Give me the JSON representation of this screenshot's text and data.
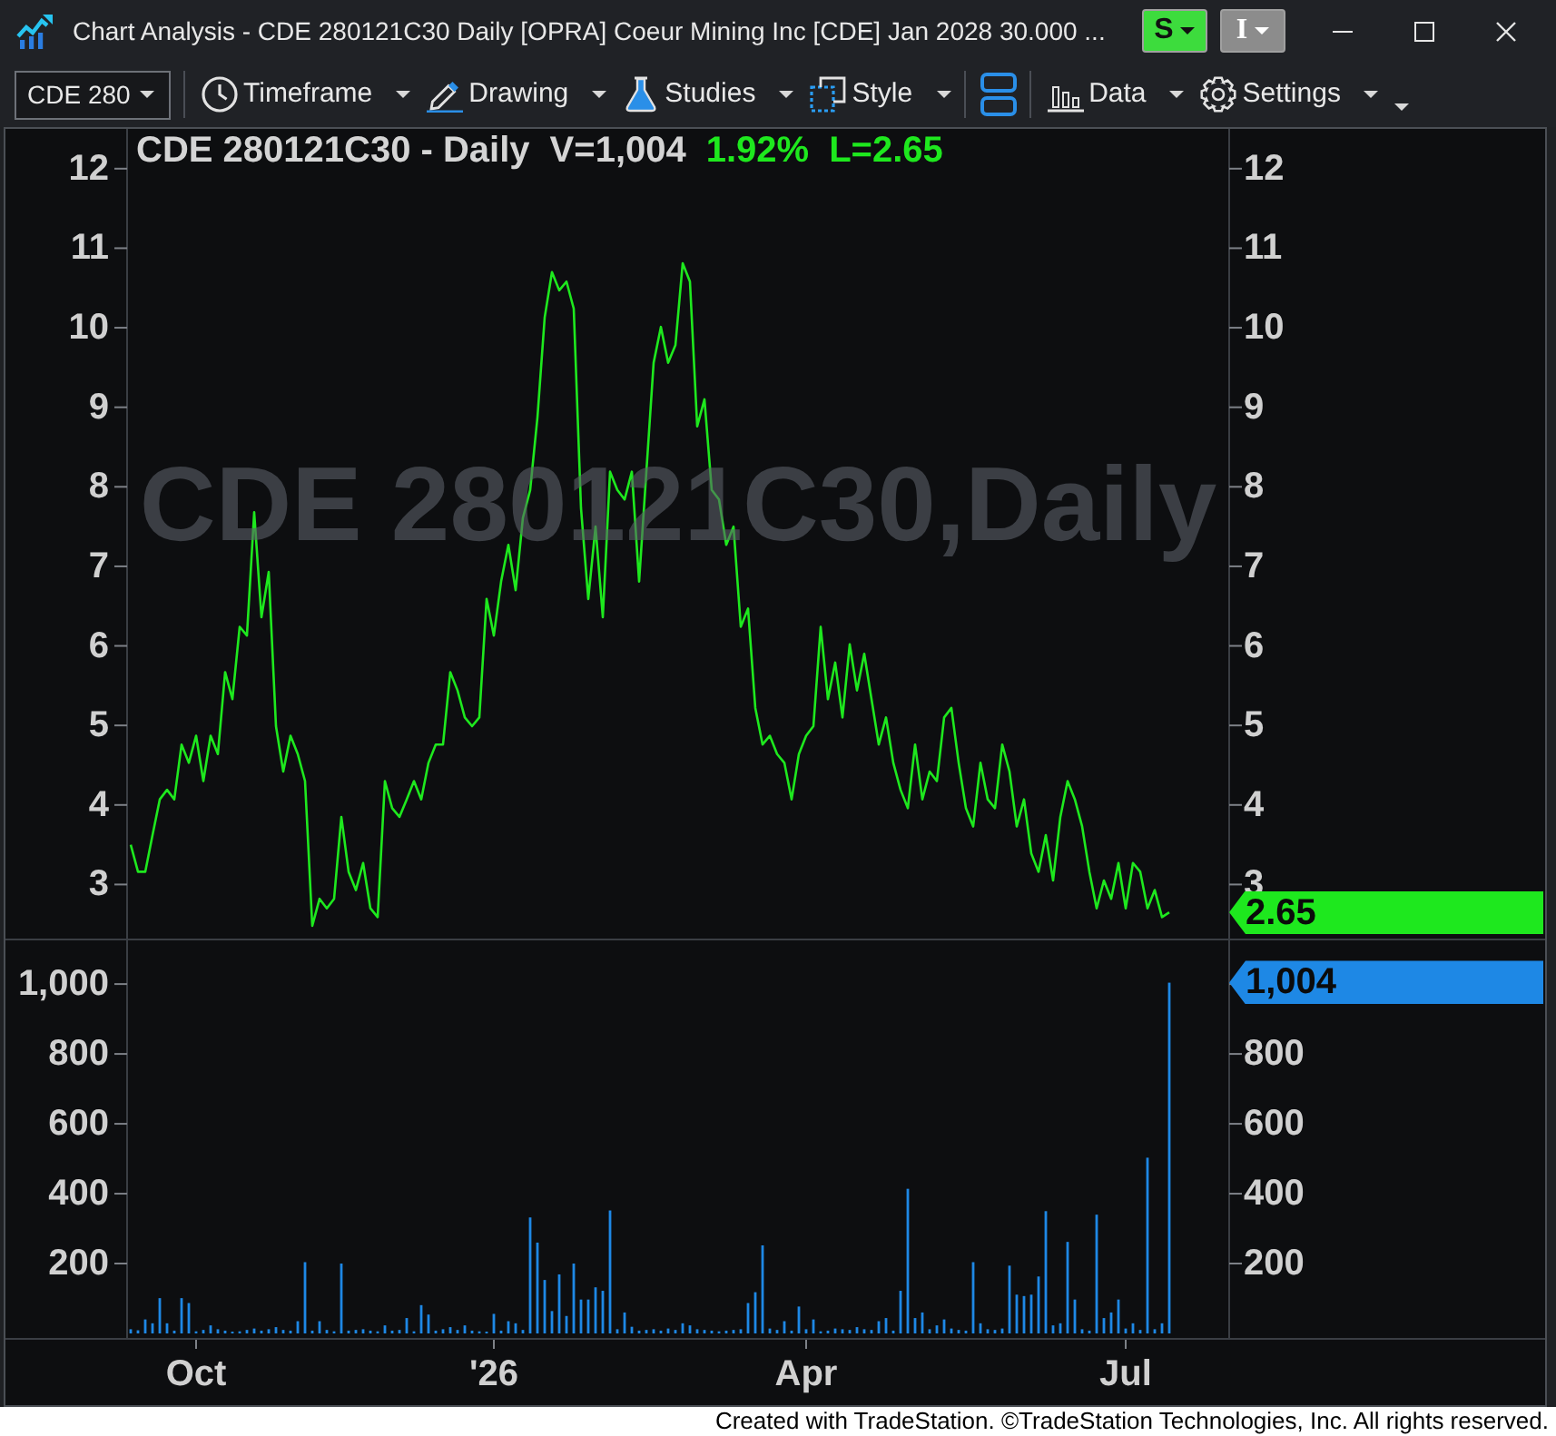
{
  "window": {
    "title": "Chart Analysis - CDE 280121C30 Daily [OPRA] Coeur Mining Inc [CDE] Jan 2028 30.000 ...",
    "title_buttons": [
      {
        "label": "S",
        "color": "#3ddc3d"
      },
      {
        "label": "I",
        "color": "#8c8c8c"
      }
    ]
  },
  "toolbar": {
    "symbol": "CDE 280",
    "items": [
      {
        "kind": "separator"
      },
      {
        "kind": "menu",
        "label": "Timeframe"
      },
      {
        "kind": "menu",
        "label": "Drawing"
      },
      {
        "kind": "menu",
        "label": "Studies"
      },
      {
        "kind": "menu",
        "label": "Style"
      },
      {
        "kind": "separator"
      },
      {
        "kind": "icon_button"
      },
      {
        "kind": "separator"
      },
      {
        "kind": "menu",
        "label": "Data"
      },
      {
        "kind": "menu",
        "label": "Settings"
      },
      {
        "kind": "overflow"
      }
    ]
  },
  "chart": {
    "price_panel": {
      "header": [
        {
          "text": "CDE 280121C30 - Daily",
          "color": "#d4d4d4"
        },
        {
          "text": "V=1,004",
          "color": "#d4d4d4"
        },
        {
          "text": "1.92%",
          "color": "#1ee81e"
        },
        {
          "text": "L=2.65",
          "color": "#1ee81e"
        }
      ],
      "background_text": "CDE 280121C30,Daily",
      "right_axis_labels": [
        "12",
        "11",
        "10",
        "9",
        "8",
        "7",
        "6",
        "5",
        "4",
        "3"
      ],
      "last_price_tag": "2.65",
      "chart_data": {
        "type": "line",
        "series": [
          {
            "color": "#1ee81e",
            "values": [
              3.5,
              3.16,
              3.16,
              3.62,
              4.07,
              4.19,
              4.07,
              4.76,
              4.53,
              4.87,
              4.3,
              4.87,
              4.64,
              5.67,
              5.33,
              6.24,
              6.13,
              7.68,
              6.36,
              6.93,
              4.99,
              4.42,
              4.87,
              4.64,
              4.3,
              2.48,
              2.82,
              2.7,
              2.82,
              3.85,
              3.16,
              2.93,
              3.27,
              2.7,
              2.59,
              4.3,
              3.96,
              3.85,
              4.07,
              4.3,
              4.07,
              4.53,
              4.76,
              4.76,
              5.67,
              5.44,
              5.1,
              4.99,
              5.1,
              6.59,
              6.13,
              6.81,
              7.27,
              6.7,
              7.61,
              7.96,
              8.87,
              10.13,
              10.7,
              10.47,
              10.58,
              10.24,
              7.73,
              6.59,
              7.5,
              6.36,
              8.19,
              7.96,
              7.84,
              8.19,
              6.81,
              8.19,
              9.56,
              10.01,
              9.56,
              9.78,
              10.81,
              10.58,
              8.76,
              9.1,
              7.96,
              7.84,
              7.27,
              7.5,
              6.24,
              6.47,
              5.22,
              4.76,
              4.87,
              4.64,
              4.53,
              4.07,
              4.64,
              4.87,
              4.99,
              6.24,
              5.33,
              5.79,
              5.1,
              6.02,
              5.44,
              5.9,
              5.33,
              4.76,
              5.1,
              4.53,
              4.19,
              3.96,
              4.76,
              4.07,
              4.42,
              4.3,
              5.1,
              5.22,
              4.53,
              3.96,
              3.73,
              4.53,
              4.07,
              3.96,
              4.76,
              4.42,
              3.73,
              4.07,
              3.39,
              3.16,
              3.62,
              3.05,
              3.85,
              4.3,
              4.07,
              3.73,
              3.16,
              2.7,
              3.05,
              2.82,
              3.27,
              2.7,
              3.27,
              3.16,
              2.7,
              2.93,
              2.59,
              2.65
            ]
          }
        ],
        "ylim": [
          2.32,
          12.5
        ],
        "yticks": [
          {
            "value": 12,
            "label": "12"
          },
          {
            "value": 11,
            "label": "11"
          },
          {
            "value": 10,
            "label": "10"
          },
          {
            "value": 9,
            "label": "9"
          },
          {
            "value": 8,
            "label": "8"
          },
          {
            "value": 7,
            "label": "7"
          },
          {
            "value": 6,
            "label": "6"
          },
          {
            "value": 5,
            "label": "5"
          },
          {
            "value": 4,
            "label": "4"
          },
          {
            "value": 3,
            "label": "3"
          }
        ]
      }
    },
    "volume_panel": {
      "right_axis_labels": [
        "800",
        "600",
        "400",
        "200"
      ],
      "last_volume_tag": "1,004",
      "chart_data": {
        "type": "bar",
        "categories": [
          null,
          null,
          null,
          null,
          null,
          null,
          null,
          null,
          null,
          "Oct",
          null,
          null,
          null,
          null,
          null,
          null,
          null,
          null,
          null,
          null,
          null,
          null,
          null,
          null,
          null,
          null,
          null,
          null,
          null,
          null,
          null,
          null,
          null,
          null,
          null,
          null,
          null,
          null,
          null,
          null,
          null,
          null,
          null,
          null,
          null,
          null,
          null,
          null,
          null,
          null,
          "'26",
          null,
          null,
          null,
          null,
          null,
          null,
          null,
          null,
          null,
          null,
          null,
          null,
          null,
          null,
          null,
          null,
          null,
          null,
          null,
          null,
          null,
          null,
          null,
          null,
          null,
          null,
          null,
          null,
          null,
          null,
          null,
          null,
          null,
          null,
          null,
          null,
          null,
          null,
          null,
          null,
          null,
          null,
          "Apr",
          null,
          null,
          null,
          null,
          null,
          null,
          null,
          null,
          null,
          null,
          null,
          null,
          null,
          null,
          null,
          null,
          null,
          null,
          null,
          null,
          null,
          null,
          null,
          null,
          null,
          null,
          null,
          null,
          null,
          null,
          null,
          null,
          null,
          null,
          null,
          null,
          null,
          null,
          null,
          null,
          null,
          null,
          null,
          "Jul",
          null,
          null,
          null,
          null,
          null,
          null
        ],
        "series": [
          {
            "color": "#1e88e5",
            "values": [
              12,
              9,
              40,
              29,
              101,
              29,
              8,
              101,
              87,
              6,
              10,
              23,
              12,
              8,
              5,
              6,
              10,
              14,
              8,
              12,
              18,
              10,
              8,
              35,
              204,
              8,
              35,
              10,
              6,
              200,
              8,
              10,
              12,
              8,
              6,
              23,
              8,
              10,
              44,
              6,
              81,
              54,
              8,
              12,
              18,
              10,
              23,
              8,
              6,
              5,
              56,
              8,
              35,
              29,
              10,
              332,
              260,
              153,
              64,
              169,
              50,
              200,
              97,
              97,
              132,
              122,
              352,
              12,
              60,
              19,
              8,
              10,
              12,
              8,
              14,
              10,
              29,
              23,
              12,
              10,
              8,
              6,
              8,
              10,
              12,
              87,
              118,
              252,
              14,
              10,
              35,
              8,
              77,
              12,
              40,
              6,
              8,
              14,
              12,
              10,
              18,
              12,
              10,
              35,
              44,
              8,
              122,
              414,
              44,
              60,
              12,
              23,
              40,
              14,
              10,
              8,
              204,
              29,
              12,
              10,
              14,
              194,
              111,
              107,
              111,
              163,
              350,
              23,
              29,
              262,
              97,
              12,
              8,
              340,
              44,
              60,
              97,
              14,
              29,
              10,
              503,
              12,
              29,
              1004
            ]
          }
        ],
        "ylim": [
          -13,
          1125
        ],
        "yticks": [
          {
            "value": 1000,
            "label": "1,000"
          },
          {
            "value": 800,
            "label": "800"
          },
          {
            "value": 600,
            "label": "600"
          },
          {
            "value": 400,
            "label": "400"
          },
          {
            "value": 200,
            "label": "200"
          }
        ]
      }
    }
  },
  "footer": "Created with TradeStation. ©TradeStation Technologies, Inc. All rights reserved."
}
